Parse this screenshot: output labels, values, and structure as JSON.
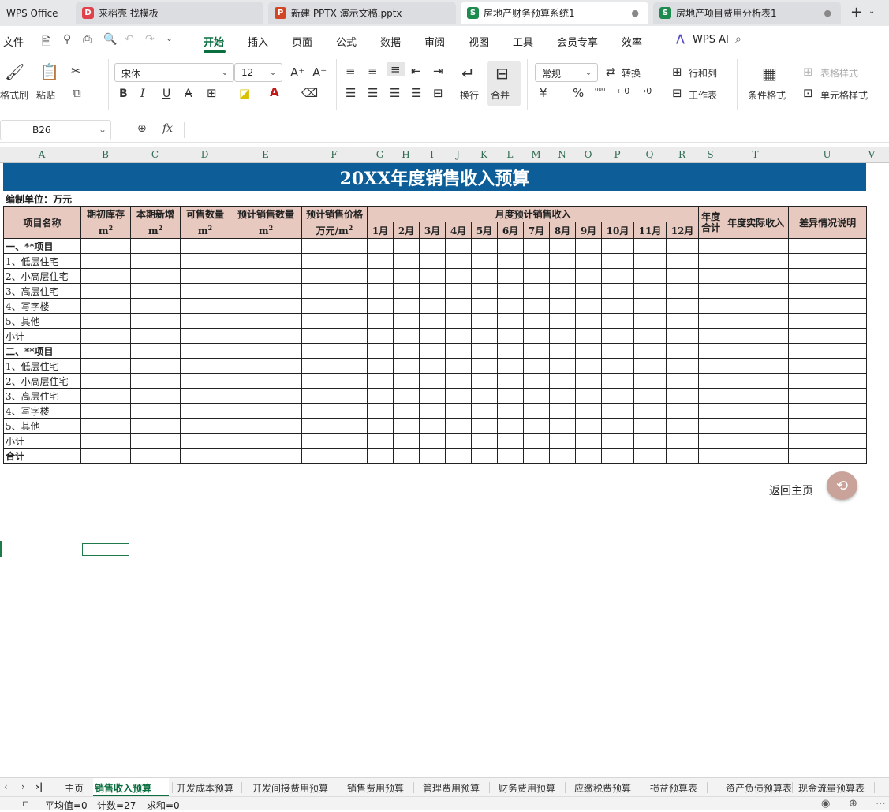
{
  "tabs": [
    {
      "label": "WPS Office",
      "icon": ""
    },
    {
      "label": "来稻壳 找模板",
      "icon": "D"
    },
    {
      "label": "新建 PPTX 演示文稿.pptx",
      "icon": "P"
    },
    {
      "label": "房地产财务预算系统1",
      "icon": "S"
    },
    {
      "label": "房地产项目费用分析表1",
      "icon": "S"
    }
  ],
  "menu": [
    "文件",
    "开始",
    "插入",
    "页面",
    "公式",
    "数据",
    "审阅",
    "视图",
    "工具",
    "会员专享",
    "效率",
    "WPS AI"
  ],
  "ribbon": {
    "format_painter": "格式刷",
    "paste": "粘贴",
    "font": "宋体",
    "size": "12",
    "bold": "B",
    "italic": "I",
    "underline": "U",
    "strike": "A",
    "wrap": "换行",
    "merge": "合并",
    "number_format": "常规",
    "convert": "转换",
    "rowcol": "行和列",
    "worksheet": "工作表",
    "cond_format": "条件格式",
    "table_style": "表格样式",
    "cell_style": "单元格样式"
  },
  "formula": {
    "namebox": "B26",
    "fx": "fx"
  },
  "columns": [
    "A",
    "B",
    "C",
    "D",
    "E",
    "F",
    "G",
    "H",
    "I",
    "J",
    "K",
    "L",
    "M",
    "N",
    "O",
    "P",
    "Q",
    "R",
    "S",
    "T",
    "U",
    "V"
  ],
  "sheet": {
    "title": "20XX年度销售收入预算",
    "unit": "编制单位：万元",
    "headers": {
      "item": "项目名称",
      "opening": "期初库存",
      "new": "本期新增",
      "available": "可售数量",
      "forecast_qty": "预计销售数量",
      "forecast_price": "预计销售价格",
      "monthly": "月度预计销售收入",
      "annual_total": "年度合计",
      "actual": "年度实际收入",
      "variance": "差异情况说明",
      "unit_m2": "m",
      "unit_price": "万元/m",
      "months": [
        "1月",
        "2月",
        "3月",
        "4月",
        "5月",
        "6月",
        "7月",
        "8月",
        "9月",
        "10月",
        "11月",
        "12月"
      ]
    },
    "rows": [
      {
        "label": "一、**项目",
        "bold": true
      },
      {
        "label": "1、低层住宅",
        "bold": false
      },
      {
        "label": "2、小高层住宅",
        "bold": false
      },
      {
        "label": "3、高层住宅",
        "bold": false
      },
      {
        "label": "4、写字楼",
        "bold": false
      },
      {
        "label": "5、其他",
        "bold": false
      },
      {
        "label": "小计",
        "bold": false
      },
      {
        "label": "二、**项目",
        "bold": true
      },
      {
        "label": "1、低层住宅",
        "bold": false
      },
      {
        "label": "2、小高层住宅",
        "bold": false
      },
      {
        "label": "3、高层住宅",
        "bold": false
      },
      {
        "label": "4、写字楼",
        "bold": false
      },
      {
        "label": "5、其他",
        "bold": false
      },
      {
        "label": "小计",
        "bold": false
      },
      {
        "label": "合计",
        "bold": true
      }
    ],
    "back_home": "返回主页"
  },
  "sheet_tabs": [
    "主页",
    "销售收入预算",
    "开发成本预算",
    "开发间接费用预算",
    "销售费用预算",
    "管理费用预算",
    "财务费用预算",
    "应缴税费预算",
    "损益预算表",
    "资产负债预算表",
    "现金流量预算表"
  ],
  "status": {
    "avg": "平均值=0",
    "count": "计数=27",
    "sum": "求和=0"
  }
}
